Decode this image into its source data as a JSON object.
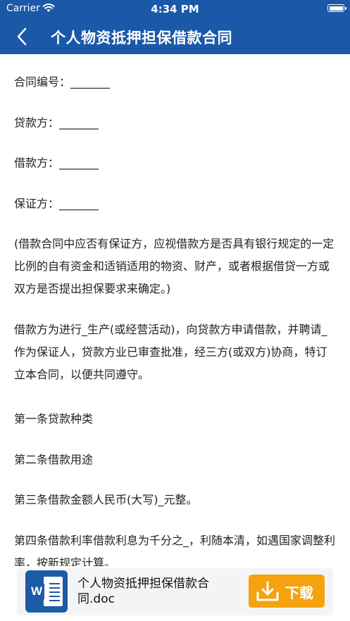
{
  "status_bar": {
    "carrier": "Carrier",
    "time": "4:34 PM"
  },
  "nav": {
    "title": "个人物资抵押担保借款合同"
  },
  "document": {
    "paragraphs": [
      "合同编号：_______",
      "贷款方：_______",
      "借款方：_______",
      "保证方：_______",
      "(借款合同中应否有保证方，应视借款方是否具有银行规定的一定比例的自有资金和适销适用的物资、财产，或者根据借贷一方或双方是否提出担保要求来确定。)",
      "借款方为进行_生产(或经营活动)，向贷款方申请借款，并聘请_作为保证人，贷款方业已审查批准，经三方(或双方)协商，特订立本合同，以便共同遵守。",
      "第一条贷款种类",
      "第二条借款用途",
      "第三条借款金额人民币(大写)_元整。",
      "第四条借款利率借款利息为千分之_，利随本清，如遇国家调整利率，按新规定计算。"
    ]
  },
  "footer": {
    "file_icon_letter": "W",
    "file_name": "个人物资抵押担保借款合同.doc",
    "download_label": "下载"
  },
  "colors": {
    "nav_bg": "#1b58a8",
    "download_bg": "#f5a20f",
    "footer_bg": "#f4f4f6"
  }
}
